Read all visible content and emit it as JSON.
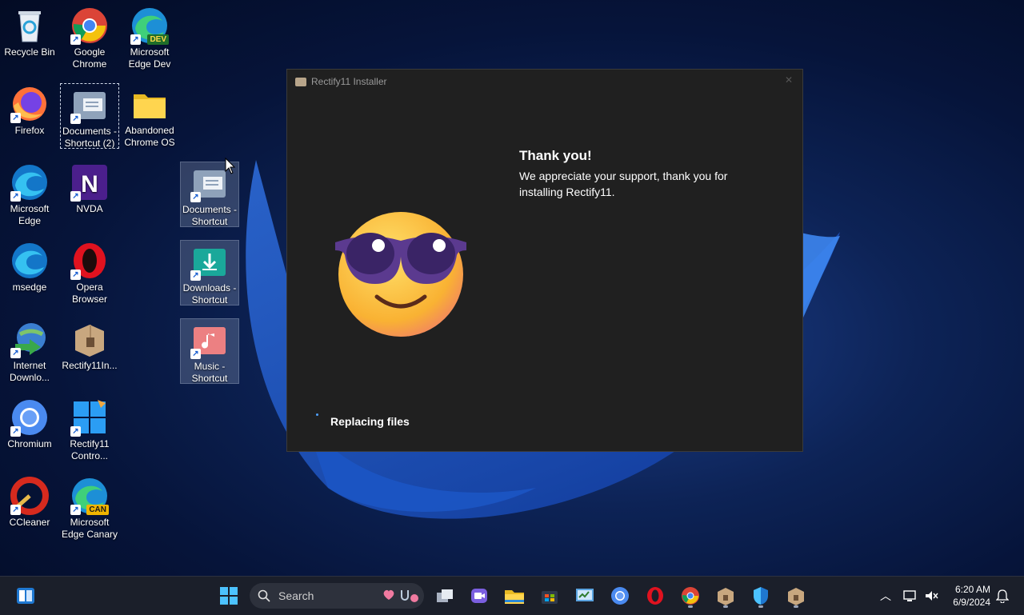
{
  "desktop": {
    "icons": [
      {
        "label": "Recycle Bin"
      },
      {
        "label": "Google Chrome"
      },
      {
        "label": "Microsoft Edge Dev",
        "badge": "DEV"
      },
      {
        "label": "Firefox"
      },
      {
        "label": "Documents - Shortcut (2)"
      },
      {
        "label": "Abandoned Chrome OS"
      },
      {
        "label": "Microsoft Edge"
      },
      {
        "label": "NVDA"
      },
      {
        "label": "Documents - Shortcut"
      },
      {
        "label": "msedge"
      },
      {
        "label": "Opera Browser"
      },
      {
        "label": "Downloads - Shortcut"
      },
      {
        "label": "Internet Downlo..."
      },
      {
        "label": "Rectify11In..."
      },
      {
        "label": "Music - Shortcut"
      },
      {
        "label": "Chromium"
      },
      {
        "label": "Rectify11 Contro..."
      },
      {
        "label": "CCleaner"
      },
      {
        "label": "Microsoft Edge Canary",
        "badge": "CAN"
      }
    ]
  },
  "installer": {
    "title": "Rectify11 Installer",
    "heading": "Thank you!",
    "message": "We appreciate your support, thank you for installing Rectify11.",
    "status": "Replacing files"
  },
  "taskbar": {
    "search_label": "Search",
    "time": "6:20 AM",
    "date": "6/9/2024"
  },
  "colors": {
    "window_bg": "#202020",
    "taskbar_bg": "#1b1f2a",
    "accent": "#4ea1ff"
  }
}
